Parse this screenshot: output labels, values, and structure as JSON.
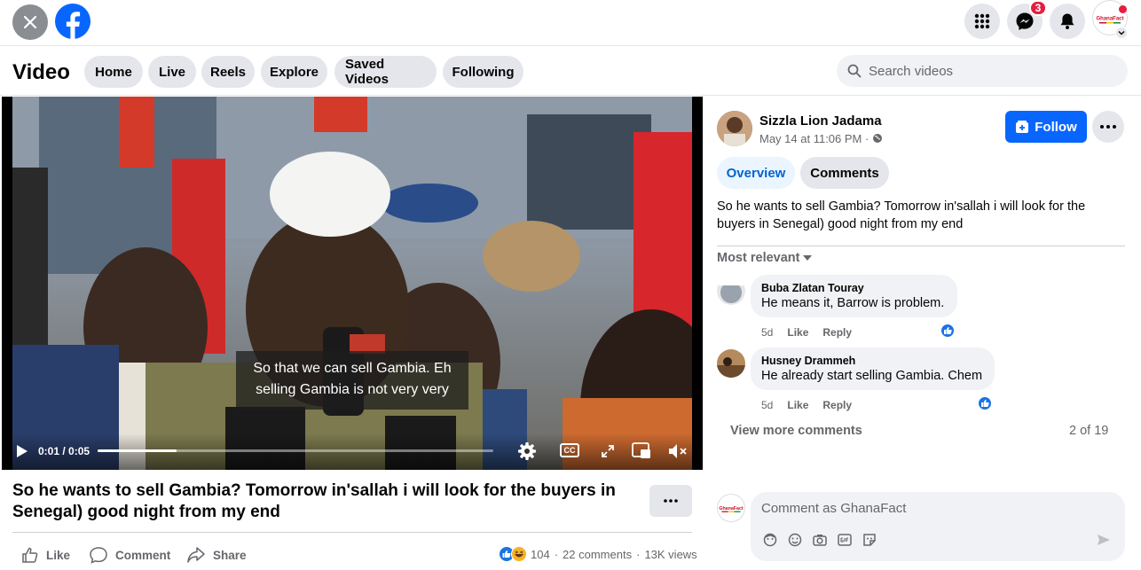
{
  "topbar": {
    "messenger_badge": "3",
    "account_logo_text": "GhanaFact"
  },
  "nav": {
    "title": "Video",
    "items": [
      {
        "label": "Home"
      },
      {
        "label": "Live"
      },
      {
        "label": "Reels"
      },
      {
        "label": "Explore"
      },
      {
        "label": "Saved Videos"
      },
      {
        "label": "Following"
      }
    ],
    "search_placeholder": "Search videos"
  },
  "player": {
    "caption_line1": "So that we can sell Gambia. Eh",
    "caption_line2": "selling Gambia is not very very",
    "time": "0:01 / 0:05",
    "progress_fraction": 0.2,
    "cc_label": "CC"
  },
  "post": {
    "author": "Sizzla Lion Jadama",
    "date": "May 14 at 11:06 PM · ",
    "follow_label": "Follow",
    "tab_overview": "Overview",
    "tab_comments": "Comments",
    "text": "So he wants to sell Gambia? Tomorrow in'sallah i will look for the buyers in Senegal) good night from my end",
    "sort_label": "Most relevant"
  },
  "comments": [
    {
      "author": "Buba Zlatan Touray",
      "text": "He means it, Barrow is problem.",
      "age": "5d",
      "like": "Like",
      "reply": "Reply"
    },
    {
      "author": "Husney Drammeh",
      "text": "He already start selling Gambia. Chem",
      "age": "5d",
      "like": "Like",
      "reply": "Reply"
    }
  ],
  "comments_footer": {
    "view_more": "View more comments",
    "count": "2 of 19"
  },
  "composer": {
    "placeholder": "Comment as GhanaFact"
  },
  "below": {
    "title": "So he wants to sell Gambia? Tomorrow in'sallah i will look for the buyers in Senegal) good night from my end",
    "like_label": "Like",
    "comment_label": "Comment",
    "share_label": "Share",
    "reactions": "104",
    "comments_count": "22 comments",
    "views": "13K views"
  },
  "colors": {
    "brand_blue": "#0866ff",
    "badge_red": "#e41e3f",
    "overview_tab_bg": "#ebf5ff"
  }
}
